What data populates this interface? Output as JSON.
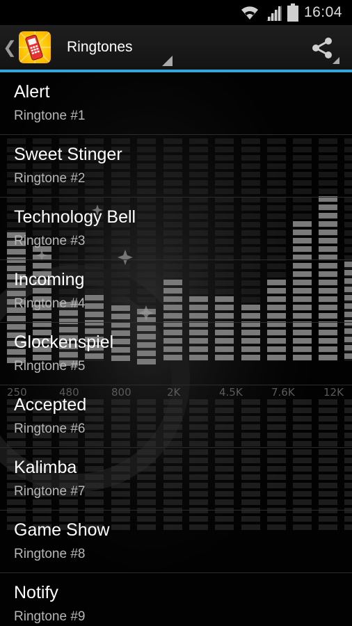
{
  "status_bar": {
    "time": "16:04",
    "icons": [
      "wifi-icon",
      "signal-icon",
      "battery-icon"
    ]
  },
  "action_bar": {
    "title": "Ringtones",
    "app_icon": "phone-ringing-icon",
    "share_icon": "share-icon",
    "accent_color": "#33a7d9"
  },
  "equalizer_labels": [
    "250",
    "480",
    "800",
    "2K",
    "4.5K",
    "7.6K",
    "12K"
  ],
  "ringtones": [
    {
      "title": "Alert",
      "subtitle": "Ringtone #1"
    },
    {
      "title": "Sweet Stinger",
      "subtitle": "Ringtone #2"
    },
    {
      "title": "Technology Bell",
      "subtitle": "Ringtone #3"
    },
    {
      "title": "Incoming",
      "subtitle": "Ringtone #4"
    },
    {
      "title": "Glockenspiel",
      "subtitle": "Ringtone #5"
    },
    {
      "title": "Accepted",
      "subtitle": "Ringtone #6"
    },
    {
      "title": "Kalimba",
      "subtitle": "Ringtone #7"
    },
    {
      "title": "Game Show",
      "subtitle": "Ringtone #8"
    },
    {
      "title": "Notify",
      "subtitle": "Ringtone #9"
    }
  ]
}
